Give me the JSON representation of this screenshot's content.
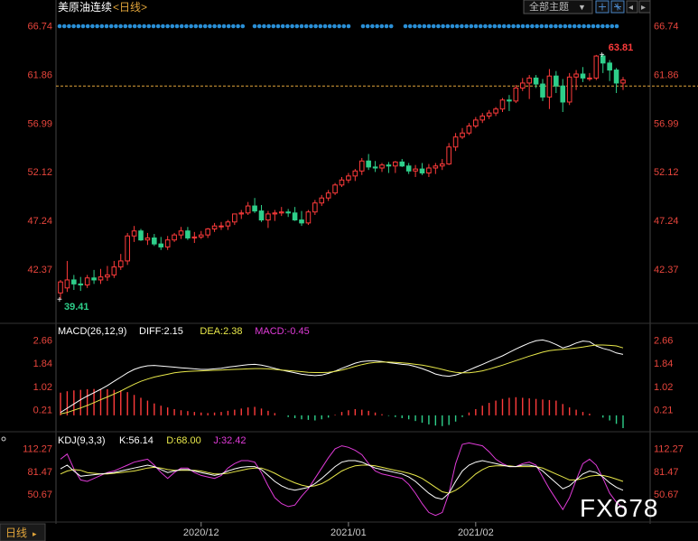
{
  "header": {
    "symbol": "美原油连续",
    "period": "<日线>",
    "theme_button": "全部主题",
    "theme_arrow": "▼",
    "nav_left": "◂",
    "nav_right": "▸"
  },
  "watermark": "FX678",
  "footer": {
    "period_tab": "日线"
  },
  "colors": {
    "up": "#ff3b3b",
    "down": "#2ecf8a",
    "axis_label": "#e8453c",
    "diff": "#ffffff",
    "dea": "#e8e84a",
    "macd_name": "#e03bd8",
    "dot": "#2a8fd6",
    "ref_line": "#e0a43a"
  },
  "chart_data": [
    {
      "type": "candlestick",
      "title": "美原油连续",
      "period": "<日线>",
      "price_ticks": [
        "66.74",
        "61.86",
        "56.99",
        "52.12",
        "47.24",
        "42.37"
      ],
      "ylim": [
        37.5,
        67.5
      ],
      "reference_price": 60.7,
      "max_label": "63.81",
      "min_label": "39.41",
      "x_labels": [
        "2020/12",
        "2021/01",
        "2021/02"
      ],
      "dates": [
        "2020-11-02",
        "2020-11-03",
        "2020-11-04",
        "2020-11-05",
        "2020-11-06",
        "2020-11-09",
        "2020-11-10",
        "2020-11-11",
        "2020-11-12",
        "2020-11-13",
        "2020-11-16",
        "2020-11-17",
        "2020-11-18",
        "2020-11-19",
        "2020-11-20",
        "2020-11-23",
        "2020-11-24",
        "2020-11-25",
        "2020-11-26",
        "2020-11-27",
        "2020-11-30",
        "2020-12-01",
        "2020-12-02",
        "2020-12-03",
        "2020-12-04",
        "2020-12-07",
        "2020-12-08",
        "2020-12-09",
        "2020-12-10",
        "2020-12-11",
        "2020-12-14",
        "2020-12-15",
        "2020-12-16",
        "2020-12-17",
        "2020-12-18",
        "2020-12-21",
        "2020-12-22",
        "2020-12-23",
        "2020-12-24",
        "2020-12-28",
        "2020-12-29",
        "2020-12-30",
        "2020-12-31",
        "2021-01-04",
        "2021-01-05",
        "2021-01-06",
        "2021-01-07",
        "2021-01-08",
        "2021-01-11",
        "2021-01-12",
        "2021-01-13",
        "2021-01-14",
        "2021-01-15",
        "2021-01-19",
        "2021-01-20",
        "2021-01-21",
        "2021-01-22",
        "2021-01-25",
        "2021-01-26",
        "2021-01-27",
        "2021-01-28",
        "2021-01-29",
        "2021-02-01",
        "2021-02-02",
        "2021-02-03",
        "2021-02-04",
        "2021-02-05",
        "2021-02-08",
        "2021-02-09",
        "2021-02-10",
        "2021-02-11",
        "2021-02-12",
        "2021-02-16",
        "2021-02-17",
        "2021-02-18",
        "2021-02-19",
        "2021-02-22",
        "2021-02-23",
        "2021-02-24",
        "2021-02-25",
        "2021-02-26",
        "2021-03-01",
        "2021-03-02",
        "2021-03-03",
        "2021-03-04",
        "2021-03-05",
        "2021-03-08",
        "2021-03-09",
        "2021-03-10",
        "2021-03-11",
        "2021-03-12",
        "2021-03-15",
        "2021-03-16",
        "2021-03-17"
      ],
      "open": [
        40.0,
        40.5,
        41.3,
        40.9,
        40.8,
        41.5,
        41.3,
        41.6,
        41.8,
        42.6,
        43.2,
        45.7,
        46.2,
        45.3,
        45.5,
        44.9,
        44.6,
        45.3,
        45.8,
        46.2,
        45.5,
        45.6,
        45.8,
        46.4,
        46.7,
        46.7,
        47.1,
        47.9,
        48.0,
        48.7,
        48.2,
        47.3,
        47.9,
        48.0,
        48.1,
        48.0,
        47.3,
        47.0,
        48.1,
        49.0,
        49.5,
        50.0,
        50.8,
        51.3,
        51.7,
        52.2,
        53.2,
        52.6,
        52.5,
        52.8,
        52.7,
        53.1,
        52.7,
        52.2,
        52.4,
        52.0,
        52.5,
        52.7,
        52.9,
        54.6,
        55.6,
        56.0,
        56.7,
        57.3,
        57.7,
        58.0,
        58.4,
        59.3,
        59.2,
        60.5,
        61.0,
        61.5,
        60.9,
        59.6,
        61.7,
        60.7,
        59.1,
        61.6,
        61.9,
        61.5,
        61.5,
        63.7,
        63.0,
        62.3,
        61.0
      ],
      "high": [
        41.3,
        43.2,
        41.8,
        41.6,
        41.8,
        42.3,
        42.4,
        42.7,
        43.2,
        43.9,
        46.0,
        46.7,
        46.4,
        46.0,
        45.9,
        45.6,
        45.7,
        46.0,
        46.6,
        46.6,
        46.1,
        46.2,
        46.5,
        47.0,
        47.1,
        47.3,
        47.9,
        48.3,
        49.1,
        49.5,
        48.8,
        48.2,
        48.3,
        48.6,
        48.4,
        48.6,
        48.2,
        48.3,
        49.3,
        49.8,
        50.3,
        51.0,
        51.6,
        52.0,
        52.4,
        53.5,
        53.9,
        53.2,
        53.0,
        53.1,
        53.2,
        53.4,
        53.0,
        52.8,
        53.0,
        52.9,
        53.0,
        53.4,
        55.0,
        56.0,
        56.5,
        57.0,
        57.6,
        58.0,
        58.3,
        58.6,
        59.5,
        59.8,
        60.8,
        61.5,
        61.8,
        61.8,
        61.4,
        62.4,
        62.2,
        61.4,
        62.0,
        62.3,
        62.6,
        62.0,
        63.81,
        63.9,
        63.3,
        62.5,
        61.6
      ],
      "low": [
        39.41,
        40.1,
        40.3,
        40.2,
        40.5,
        40.9,
        40.9,
        41.2,
        41.5,
        42.3,
        42.8,
        45.1,
        45.2,
        44.8,
        44.7,
        44.3,
        44.3,
        45.1,
        45.4,
        45.3,
        45.0,
        45.4,
        45.5,
        46.1,
        46.3,
        46.3,
        46.8,
        47.4,
        47.8,
        48.0,
        47.1,
        46.5,
        47.2,
        47.7,
        47.6,
        47.2,
        46.7,
        46.8,
        47.8,
        48.7,
        49.2,
        49.8,
        50.6,
        51.0,
        51.2,
        51.8,
        52.3,
        52.1,
        52.1,
        52.0,
        52.0,
        52.6,
        51.9,
        51.6,
        51.8,
        51.6,
        51.9,
        52.3,
        52.8,
        54.2,
        55.4,
        55.8,
        56.5,
        57.0,
        57.4,
        57.7,
        58.1,
        58.2,
        59.0,
        60.2,
        59.4,
        60.5,
        59.2,
        58.4,
        60.0,
        58.1,
        58.8,
        60.3,
        61.1,
        61.2,
        61.3,
        62.0,
        61.2,
        60.0,
        60.3
      ],
      "close": [
        41.1,
        41.3,
        40.9,
        40.8,
        41.5,
        41.3,
        41.6,
        41.8,
        42.6,
        43.2,
        45.7,
        46.2,
        45.3,
        45.5,
        44.9,
        44.6,
        45.3,
        45.8,
        46.2,
        45.5,
        45.6,
        45.8,
        46.4,
        46.7,
        46.7,
        47.1,
        47.9,
        48.0,
        48.7,
        48.2,
        47.3,
        47.9,
        48.0,
        48.1,
        48.0,
        47.3,
        47.0,
        48.1,
        49.0,
        49.5,
        50.0,
        50.8,
        51.3,
        51.7,
        52.2,
        53.2,
        52.6,
        52.5,
        52.8,
        52.7,
        53.1,
        52.7,
        52.2,
        52.4,
        52.0,
        52.5,
        52.7,
        52.9,
        54.6,
        55.6,
        56.0,
        56.7,
        57.3,
        57.7,
        58.0,
        58.4,
        59.3,
        59.2,
        60.5,
        61.0,
        61.5,
        60.9,
        59.6,
        61.7,
        60.7,
        59.1,
        61.6,
        61.9,
        61.5,
        61.5,
        63.7,
        63.0,
        62.3,
        61.0,
        61.3
      ],
      "dots_count": 4
    },
    {
      "type": "line",
      "title": "MACD(26,12,9)",
      "indicators": [
        {
          "label": "DIFF:2.15",
          "color_key": "diff"
        },
        {
          "label": "DEA:2.38",
          "color_key": "dea"
        },
        {
          "label": "MACD:-0.45",
          "color_key": "macd_name"
        }
      ],
      "ticks": [
        "2.66",
        "1.84",
        "1.02",
        "0.21"
      ],
      "ylim": [
        -0.45,
        2.8
      ],
      "diff": [
        0.1,
        0.25,
        0.4,
        0.55,
        0.68,
        0.8,
        0.92,
        1.05,
        1.2,
        1.35,
        1.5,
        1.62,
        1.7,
        1.75,
        1.76,
        1.74,
        1.72,
        1.7,
        1.68,
        1.66,
        1.64,
        1.62,
        1.62,
        1.64,
        1.66,
        1.7,
        1.73,
        1.76,
        1.79,
        1.8,
        1.77,
        1.72,
        1.66,
        1.6,
        1.55,
        1.5,
        1.45,
        1.42,
        1.4,
        1.42,
        1.48,
        1.56,
        1.66,
        1.75,
        1.84,
        1.9,
        1.92,
        1.92,
        1.9,
        1.86,
        1.83,
        1.8,
        1.78,
        1.72,
        1.65,
        1.56,
        1.46,
        1.4,
        1.38,
        1.42,
        1.5,
        1.6,
        1.7,
        1.8,
        1.9,
        2.0,
        2.1,
        2.22,
        2.34,
        2.45,
        2.55,
        2.63,
        2.66,
        2.6,
        2.5,
        2.38,
        2.45,
        2.55,
        2.62,
        2.6,
        2.45,
        2.36,
        2.3,
        2.2,
        2.15
      ],
      "dea": [
        0.05,
        0.1,
        0.18,
        0.26,
        0.35,
        0.45,
        0.55,
        0.65,
        0.75,
        0.86,
        0.98,
        1.1,
        1.2,
        1.28,
        1.35,
        1.4,
        1.45,
        1.5,
        1.53,
        1.55,
        1.56,
        1.57,
        1.58,
        1.59,
        1.6,
        1.61,
        1.62,
        1.63,
        1.64,
        1.65,
        1.65,
        1.64,
        1.62,
        1.6,
        1.58,
        1.56,
        1.54,
        1.52,
        1.51,
        1.51,
        1.52,
        1.55,
        1.6,
        1.66,
        1.73,
        1.79,
        1.84,
        1.87,
        1.88,
        1.88,
        1.87,
        1.85,
        1.83,
        1.8,
        1.77,
        1.73,
        1.68,
        1.62,
        1.56,
        1.52,
        1.5,
        1.5,
        1.53,
        1.57,
        1.63,
        1.7,
        1.77,
        1.85,
        1.93,
        2.01,
        2.09,
        2.16,
        2.23,
        2.28,
        2.31,
        2.33,
        2.35,
        2.38,
        2.41,
        2.45,
        2.48,
        2.48,
        2.47,
        2.45,
        2.38
      ],
      "macd": [
        0.8,
        0.85,
        0.88,
        0.9,
        0.92,
        0.93,
        0.93,
        0.92,
        0.9,
        0.88,
        0.82,
        0.72,
        0.62,
        0.52,
        0.42,
        0.34,
        0.28,
        0.22,
        0.18,
        0.15,
        0.12,
        0.1,
        0.08,
        0.1,
        0.12,
        0.16,
        0.2,
        0.24,
        0.28,
        0.3,
        0.24,
        0.16,
        0.08,
        0.0,
        -0.06,
        -0.1,
        -0.14,
        -0.16,
        -0.18,
        -0.14,
        -0.08,
        0.02,
        0.12,
        0.18,
        0.22,
        0.2,
        0.16,
        0.1,
        0.04,
        -0.02,
        -0.06,
        -0.1,
        -0.14,
        -0.2,
        -0.26,
        -0.32,
        -0.36,
        -0.38,
        -0.34,
        -0.22,
        -0.06,
        0.1,
        0.22,
        0.34,
        0.44,
        0.52,
        0.58,
        0.62,
        0.64,
        0.62,
        0.6,
        0.58,
        0.56,
        0.54,
        0.52,
        0.4,
        0.28,
        0.2,
        0.12,
        0.06,
        0.0,
        -0.08,
        -0.18,
        -0.3,
        -0.45
      ]
    },
    {
      "type": "line",
      "title": "KDJ(9,3,3)",
      "indicators": [
        {
          "label": "K:56.14",
          "color_key": "diff"
        },
        {
          "label": "D:68.00",
          "color_key": "dea"
        },
        {
          "label": "J:32.42",
          "color_key": "macd_name"
        }
      ],
      "ticks": [
        "112.27",
        "81.47",
        "50.67"
      ],
      "ylim": [
        18,
        118
      ],
      "k": [
        85,
        90,
        82,
        75,
        76,
        77,
        78,
        79,
        80,
        82,
        84,
        86,
        88,
        90,
        88,
        84,
        80,
        82,
        84,
        84,
        82,
        80,
        78,
        76,
        78,
        82,
        85,
        87,
        88,
        88,
        84,
        76,
        68,
        62,
        58,
        56,
        58,
        60,
        65,
        72,
        80,
        88,
        94,
        96,
        96,
        94,
        90,
        86,
        84,
        82,
        80,
        78,
        74,
        68,
        60,
        52,
        46,
        44,
        52,
        68,
        82,
        90,
        94,
        96,
        94,
        92,
        90,
        88,
        88,
        90,
        90,
        88,
        82,
        74,
        66,
        58,
        62,
        70,
        78,
        82,
        80,
        74,
        66,
        60,
        56
      ],
      "d": [
        78,
        82,
        84,
        83,
        80,
        79,
        78,
        78,
        79,
        80,
        81,
        82,
        84,
        86,
        87,
        86,
        84,
        83,
        83,
        83,
        83,
        82,
        80,
        78,
        78,
        79,
        81,
        83,
        85,
        86,
        86,
        83,
        79,
        74,
        70,
        66,
        63,
        61,
        62,
        65,
        70,
        76,
        82,
        86,
        89,
        90,
        90,
        89,
        87,
        85,
        83,
        81,
        79,
        76,
        72,
        66,
        60,
        54,
        52,
        56,
        62,
        70,
        78,
        84,
        88,
        89,
        89,
        89,
        88,
        88,
        88,
        88,
        86,
        82,
        78,
        74,
        70,
        70,
        72,
        75,
        76,
        76,
        74,
        71,
        68
      ],
      "j": [
        98,
        105,
        85,
        70,
        68,
        72,
        76,
        80,
        82,
        86,
        90,
        94,
        96,
        98,
        90,
        80,
        72,
        80,
        86,
        86,
        80,
        76,
        74,
        72,
        76,
        86,
        92,
        96,
        96,
        94,
        80,
        62,
        46,
        38,
        34,
        36,
        48,
        58,
        72,
        86,
        100,
        112,
        116,
        114,
        110,
        104,
        92,
        82,
        78,
        76,
        74,
        72,
        64,
        52,
        38,
        26,
        22,
        26,
        52,
        92,
        118,
        120,
        118,
        116,
        108,
        98,
        92,
        88,
        88,
        92,
        94,
        90,
        74,
        58,
        44,
        30,
        46,
        70,
        92,
        98,
        90,
        72,
        52,
        40,
        32
      ]
    }
  ]
}
